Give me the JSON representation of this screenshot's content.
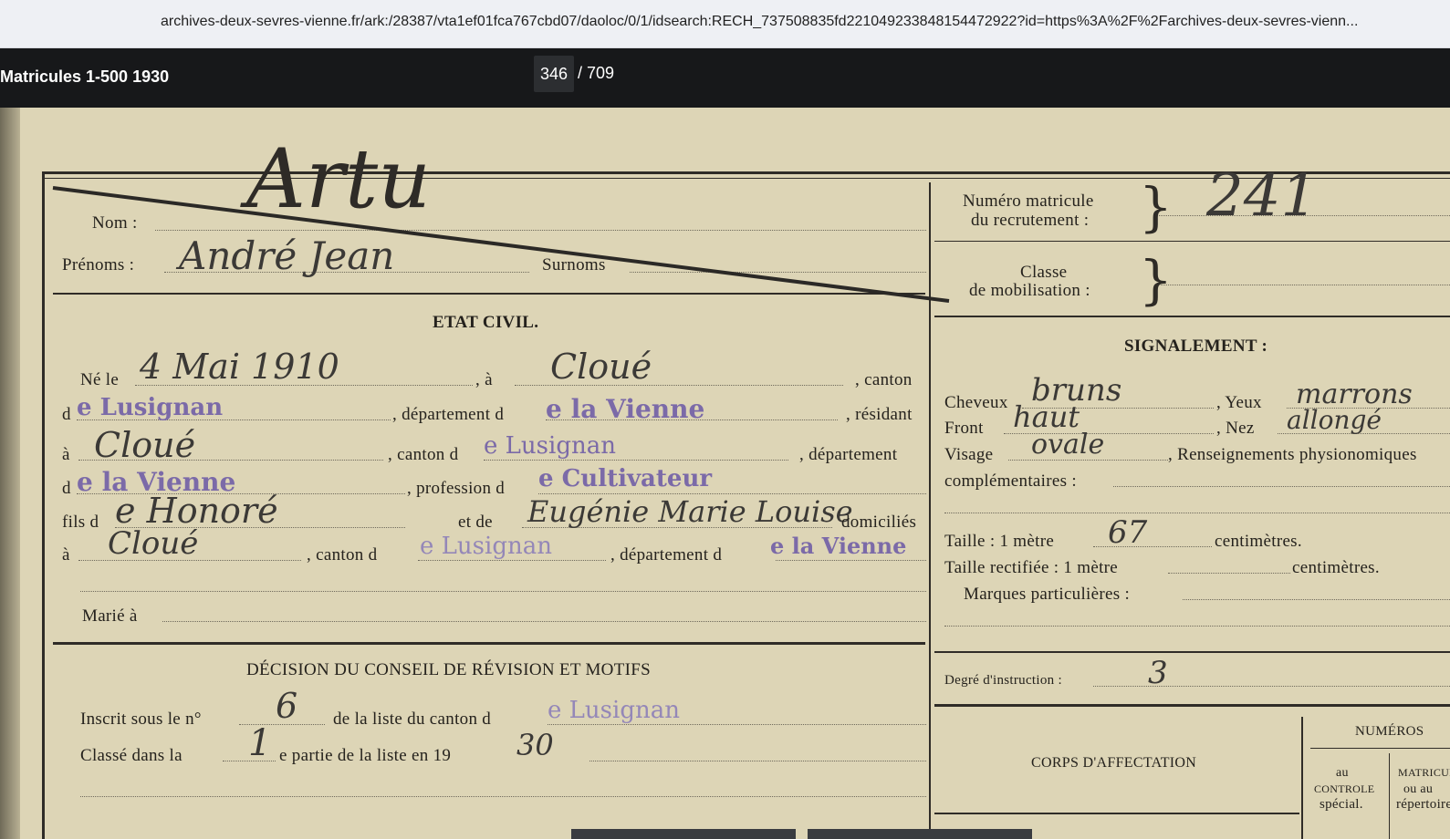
{
  "browser": {
    "url": "archives-deux-sevres-vienne.fr/ark:/28387/vta1ef01fca767cbd07/daoloc/0/1/idsearch:RECH_737508835fd2210492338481544729​22?id=https%3A%2F%2Farchives-deux-sevres-vienn..."
  },
  "viewer": {
    "title": "Matricules 1-500 1930",
    "page_current": "346",
    "page_total": "/ 709"
  },
  "form": {
    "nom_label": "Nom :",
    "nom_value": "Artu",
    "prenoms_label": "Prénoms :",
    "prenoms_value": "André Jean",
    "surnoms_label": "Surnoms",
    "numero_label_1": "Numéro matricule",
    "numero_label_2": "du recrutement :",
    "numero_value": "241",
    "classe_label_1": "Classe",
    "classe_label_2": "de mobilisation :",
    "etat_civil": "ETAT CIVIL.",
    "ne_le": "Né le",
    "birth_date": "4 Mai 1910",
    "a_label": ", à",
    "birth_place": "Cloué",
    "canton_label": ", canton",
    "d_label": "d",
    "canton_value": "e Lusignan",
    "departement_label": ", département d",
    "departement_value": "e la Vienne",
    "residant_label": ", résidant",
    "a2_label": "à",
    "residence": "Cloué",
    "canton2_label": ", canton d",
    "canton2_value": "e Lusignan",
    "departement2_label": ", département",
    "de_label": "d",
    "departement3_value": "e la Vienne",
    "profession_label": ", profession d",
    "profession_value": "e Cultivateur",
    "fils_label": "fils d",
    "father": "e Honoré",
    "et_de_label": "et de",
    "mother": "Eugénie Marie Louise",
    "domicilies_label": "domiciliés",
    "a3_label": "à",
    "domicile": "Cloué",
    "canton3_label": ", canton d",
    "canton3_value": "e Lusignan",
    "departement4_label": ", département d",
    "departement4_value": "e la Vienne",
    "marie_label": "Marié à",
    "signalement": "SIGNALEMENT :",
    "cheveux_label": "Cheveux",
    "cheveux_value": "bruns",
    "yeux_label": ", Yeux",
    "yeux_value": "marrons",
    "front_label": "Front",
    "front_value": "haut",
    "nez_label": ", Nez",
    "nez_value": "allongé",
    "visage_label": "Visage",
    "visage_value": "ovale",
    "renseignements_label": ", Renseignements physionomiques",
    "complementaires_label": "complémentaires :",
    "taille_label": "Taille : 1 mètre",
    "taille_value": "67",
    "centimetres_label": "centimètres.",
    "taille_rect_label": "Taille rectifiée : 1 mètre",
    "centimetres2_label": "centimètres.",
    "marques_label": "Marques particulières :",
    "degre_label": "Degré d'instruction :",
    "degre_value": "3",
    "decision_title": "DÉCISION DU CONSEIL DE RÉVISION ET MOTIFS",
    "inscrit_label": "Inscrit sous le n°",
    "inscrit_value": "6",
    "liste_label": "de la liste du canton d",
    "liste_value": "e Lusignan",
    "classe_dans_label": "Classé dans la",
    "classe_dans_value": "1",
    "partie_label": "e partie de la liste en 19",
    "annee_value": "30",
    "corps_label": "CORPS D'AFFECTATION",
    "numeros_label": "NUMÉROS",
    "controle_label_1": "au",
    "controle_label_2": "CONTROLE",
    "controle_label_3": "spécial.",
    "matricule_label_1": "MATRICULE",
    "matricule_label_2": "ou au",
    "matricule_label_3": "répertoire"
  }
}
